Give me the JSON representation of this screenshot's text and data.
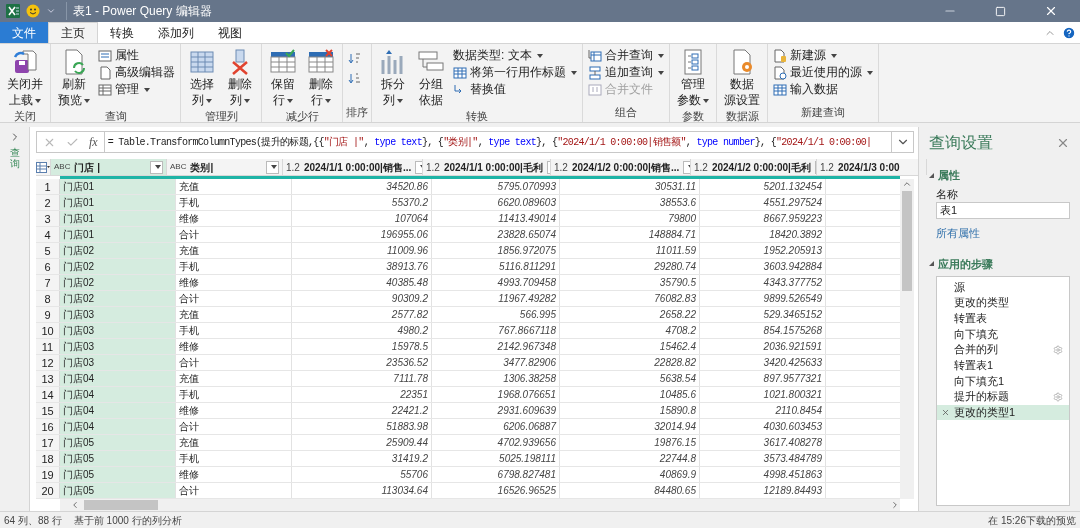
{
  "title_bar": {
    "title": "表1 - Power Query 编辑器"
  },
  "tabs": [
    {
      "label": "文件",
      "kind": "file",
      "selected": false
    },
    {
      "label": "主页",
      "kind": "tab",
      "selected": true
    },
    {
      "label": "转换",
      "kind": "tab",
      "selected": false
    },
    {
      "label": "添加列",
      "kind": "tab",
      "selected": false
    },
    {
      "label": "视图",
      "kind": "tab",
      "selected": false
    }
  ],
  "ribbon": [
    {
      "label": "关闭",
      "buttons": [
        {
          "kind": "large",
          "lines": [
            "关闭并",
            "上载"
          ],
          "dropdown": true
        }
      ]
    },
    {
      "label": "查询",
      "buttons": [
        {
          "kind": "large",
          "lines": [
            "刷新",
            "预览"
          ],
          "dropdown": true
        },
        {
          "kind": "small",
          "lines": [
            "属性"
          ],
          "dropdown": false
        },
        {
          "kind": "small",
          "lines": [
            "高级编辑器"
          ],
          "dropdown": false
        },
        {
          "kind": "small",
          "lines": [
            "管理"
          ],
          "dropdown": true
        }
      ]
    },
    {
      "label": "管理列",
      "buttons": [
        {
          "kind": "large",
          "lines": [
            "选择",
            "列"
          ],
          "dropdown": true
        },
        {
          "kind": "large",
          "lines": [
            "删除",
            "列"
          ],
          "dropdown": true
        }
      ]
    },
    {
      "label": "减少行",
      "buttons": [
        {
          "kind": "large",
          "lines": [
            "保留",
            "行"
          ],
          "dropdown": true
        },
        {
          "kind": "large",
          "lines": [
            "删除",
            "行"
          ],
          "dropdown": true
        }
      ]
    },
    {
      "label": "排序",
      "buttons": [
        {
          "kind": "icon"
        },
        {
          "kind": "icon"
        }
      ]
    },
    {
      "label": "转换",
      "buttons": [
        {
          "kind": "large",
          "lines": [
            "拆分",
            "列"
          ],
          "dropdown": true
        },
        {
          "kind": "large",
          "lines": [
            "分组",
            "依据"
          ],
          "dropdown": false
        },
        {
          "kind": "small",
          "lines": [
            "数据类型: 文本"
          ],
          "dropdown": true
        },
        {
          "kind": "small",
          "lines": [
            "将第一行用作标题"
          ],
          "dropdown": true
        },
        {
          "kind": "small",
          "lines": [
            "替换值"
          ],
          "dropdown": false
        }
      ]
    },
    {
      "label": "组合",
      "buttons": [
        {
          "kind": "small",
          "lines": [
            "合并查询"
          ],
          "dropdown": true
        },
        {
          "kind": "small",
          "lines": [
            "追加查询"
          ],
          "dropdown": true
        },
        {
          "kind": "small",
          "lines": [
            "合并文件"
          ],
          "dropdown": false,
          "disabled": true
        }
      ]
    },
    {
      "label": "参数",
      "buttons": [
        {
          "kind": "large",
          "lines": [
            "管理",
            "参数"
          ],
          "dropdown": true
        }
      ]
    },
    {
      "label": "数据源",
      "buttons": [
        {
          "kind": "large",
          "lines": [
            "数据",
            "源设置"
          ],
          "dropdown": false
        }
      ]
    },
    {
      "label": "新建查询",
      "buttons": [
        {
          "kind": "small",
          "lines": [
            "新建源"
          ],
          "dropdown": true
        },
        {
          "kind": "small",
          "lines": [
            "最近使用的源"
          ],
          "dropdown": true
        },
        {
          "kind": "small",
          "lines": [
            "输入数据"
          ],
          "dropdown": false
        }
      ]
    }
  ],
  "nav": {
    "label": "查询"
  },
  "formula_bar": {
    "fx": "fx",
    "segments": [
      {
        "kind": "plain",
        "text": "= Table.TransformColumnTypes(提升的标题,{{"
      },
      {
        "kind": "string",
        "text": "\"门店 |\""
      },
      {
        "kind": "plain",
        "text": ", "
      },
      {
        "kind": "keyword",
        "text": "type text"
      },
      {
        "kind": "plain",
        "text": "}, {"
      },
      {
        "kind": "string",
        "text": "\"类别|\""
      },
      {
        "kind": "plain",
        "text": ", "
      },
      {
        "kind": "keyword",
        "text": "type text"
      },
      {
        "kind": "plain",
        "text": "}, {"
      },
      {
        "kind": "string",
        "text": "\"2024/1/1 0:00:00|销售额\""
      },
      {
        "kind": "plain",
        "text": ", "
      },
      {
        "kind": "keyword",
        "text": "type number"
      },
      {
        "kind": "plain",
        "text": "}, {"
      },
      {
        "kind": "string",
        "text": "\"2024/1/1 0:00:00|"
      }
    ]
  },
  "table": {
    "columns": [
      {
        "type": "ABC",
        "name": "门店 |",
        "selected": true
      },
      {
        "type": "ABC",
        "name": "类别|",
        "selected": false
      },
      {
        "type": "1.2",
        "name": "2024/1/1 0:00:00|销售...",
        "selected": false
      },
      {
        "type": "1.2",
        "name": "2024/1/1 0:00:00|毛利",
        "selected": false
      },
      {
        "type": "1.2",
        "name": "2024/1/2 0:00:00|销售...",
        "selected": false
      },
      {
        "type": "1.2",
        "name": "2024/1/2 0:00:00|毛利",
        "selected": false
      },
      {
        "type": "1.2",
        "name": "2024/1/3 0:00",
        "selected": false
      }
    ],
    "rows": [
      {
        "index": "1",
        "cells": [
          "门店01",
          "充值",
          "34520.86",
          "5795.070993",
          "30531.11",
          "5201.132454"
        ]
      },
      {
        "index": "2",
        "cells": [
          "门店01",
          "手机",
          "55370.2",
          "6620.089603",
          "38553.6",
          "4551.297524"
        ]
      },
      {
        "index": "3",
        "cells": [
          "门店01",
          "维修",
          "107064",
          "11413.49014",
          "79800",
          "8667.959223"
        ]
      },
      {
        "index": "4",
        "cells": [
          "门店01",
          "合计",
          "196955.06",
          "23828.65074",
          "148884.71",
          "18420.3892"
        ]
      },
      {
        "index": "5",
        "cells": [
          "门店02",
          "充值",
          "11009.96",
          "1856.972075",
          "11011.59",
          "1952.205913"
        ]
      },
      {
        "index": "6",
        "cells": [
          "门店02",
          "手机",
          "38913.76",
          "5116.811291",
          "29280.74",
          "3603.942884"
        ]
      },
      {
        "index": "7",
        "cells": [
          "门店02",
          "维修",
          "40385.48",
          "4993.709458",
          "35790.5",
          "4343.377752"
        ]
      },
      {
        "index": "8",
        "cells": [
          "门店02",
          "合计",
          "90309.2",
          "11967.49282",
          "76082.83",
          "9899.526549"
        ]
      },
      {
        "index": "9",
        "cells": [
          "门店03",
          "充值",
          "2577.82",
          "566.995",
          "2658.22",
          "529.3465152"
        ]
      },
      {
        "index": "10",
        "cells": [
          "门店03",
          "手机",
          "4980.2",
          "767.8667118",
          "4708.2",
          "854.1575268"
        ]
      },
      {
        "index": "11",
        "cells": [
          "门店03",
          "维修",
          "15978.5",
          "2142.967348",
          "15462.4",
          "2036.921591"
        ]
      },
      {
        "index": "12",
        "cells": [
          "门店03",
          "合计",
          "23536.52",
          "3477.82906",
          "22828.82",
          "3420.425633"
        ]
      },
      {
        "index": "13",
        "cells": [
          "门店04",
          "充值",
          "7111.78",
          "1306.38258",
          "5638.54",
          "897.9577321"
        ]
      },
      {
        "index": "14",
        "cells": [
          "门店04",
          "手机",
          "22351",
          "1968.076651",
          "10485.6",
          "1021.800321"
        ]
      },
      {
        "index": "15",
        "cells": [
          "门店04",
          "维修",
          "22421.2",
          "2931.609639",
          "15890.8",
          "2110.8454"
        ]
      },
      {
        "index": "16",
        "cells": [
          "门店04",
          "合计",
          "51883.98",
          "6206.06887",
          "32014.94",
          "4030.603453"
        ]
      },
      {
        "index": "17",
        "cells": [
          "门店05",
          "充值",
          "25909.44",
          "4702.939656",
          "19876.15",
          "3617.408278"
        ]
      },
      {
        "index": "18",
        "cells": [
          "门店05",
          "手机",
          "31419.2",
          "5025.198111",
          "22744.8",
          "3573.484789"
        ]
      },
      {
        "index": "19",
        "cells": [
          "门店05",
          "维修",
          "55706",
          "6798.827481",
          "40869.9",
          "4998.451863"
        ]
      },
      {
        "index": "20",
        "cells": [
          "门店05",
          "合计",
          "113034.64",
          "16526.96525",
          "84480.65",
          "12189.84493"
        ]
      }
    ]
  },
  "query_settings": {
    "title": "查询设置",
    "properties_label": "属性",
    "name_label": "名称",
    "name_value": "表1",
    "all_properties": "所有属性",
    "steps_label": "应用的步骤",
    "steps": [
      {
        "label": "源",
        "settings": false,
        "selected": false
      },
      {
        "label": "更改的类型",
        "settings": false,
        "selected": false
      },
      {
        "label": "转置表",
        "settings": false,
        "selected": false
      },
      {
        "label": "向下填充",
        "settings": false,
        "selected": false
      },
      {
        "label": "合并的列",
        "settings": true,
        "selected": false
      },
      {
        "label": "转置表1",
        "settings": false,
        "selected": false
      },
      {
        "label": "向下填充1",
        "settings": false,
        "selected": false
      },
      {
        "label": "提升的标题",
        "settings": true,
        "selected": false
      },
      {
        "label": "更改的类型1",
        "settings": false,
        "selected": true
      }
    ]
  },
  "status_bar": {
    "columns_rows": "64 列、88 行",
    "profiling": "基于前 1000 行的列分析",
    "preview": "在 15:26下载的预览"
  }
}
